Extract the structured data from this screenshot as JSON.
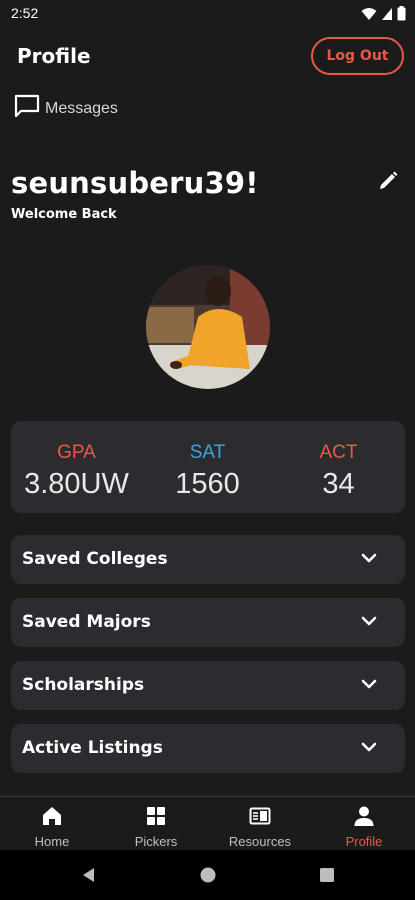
{
  "status_bar": {
    "time": "2:52"
  },
  "header": {
    "title": "Profile",
    "logout_label": "Log Out"
  },
  "messages": {
    "label": "Messages"
  },
  "profile": {
    "username": "seunsuberu39!",
    "greeting": "Welcome Back"
  },
  "stats": [
    {
      "label": "GPA",
      "value": "3.80UW",
      "color": "#e85a45"
    },
    {
      "label": "SAT",
      "value": "1560",
      "color": "#3ea4d8"
    },
    {
      "label": "ACT",
      "value": "34",
      "color": "#e85a45"
    }
  ],
  "sections": [
    {
      "title": "Saved Colleges"
    },
    {
      "title": "Saved Majors"
    },
    {
      "title": "Scholarships"
    },
    {
      "title": "Active Listings"
    }
  ],
  "bottom_nav": [
    {
      "label": "Home",
      "icon": "home-icon"
    },
    {
      "label": "Pickers",
      "icon": "grid-icon"
    },
    {
      "label": "Resources",
      "icon": "book-icon"
    },
    {
      "label": "Profile",
      "icon": "person-icon",
      "active": true
    }
  ],
  "colors": {
    "accent": "#e85a45",
    "sat_blue": "#3ea4d8",
    "card": "#2c2c30",
    "background": "#1b1b1c"
  }
}
